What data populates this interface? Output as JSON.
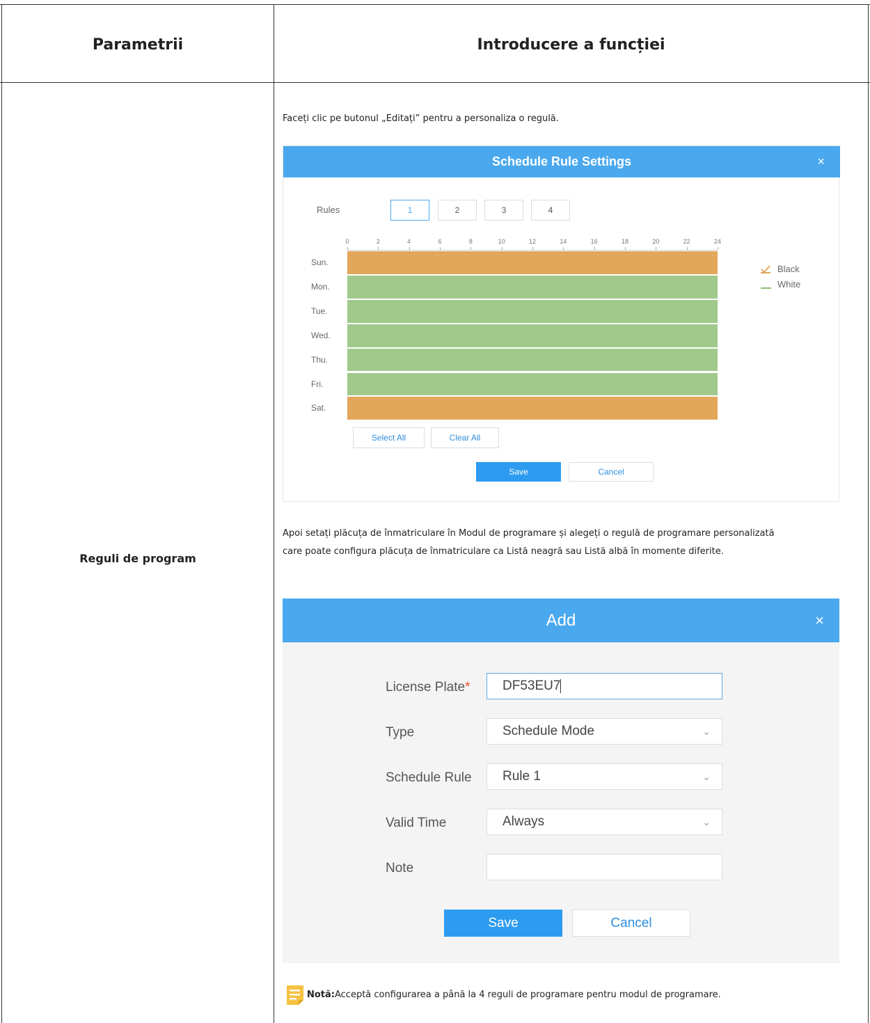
{
  "table": {
    "header_left": "Parametrii",
    "header_right": "Introducere a funcției",
    "row_param": "Reguli de program"
  },
  "content": {
    "intro": "Faceți clic pe butonul „Editați” pentru a personaliza o regulă.",
    "para_line1": "Apoi setați plăcuța de înmatriculare în Modul de programare și alegeți o regulă de programare personalizată",
    "para_line2": "care poate configura plăcuța de înmatriculare ca Listă neagră sau Listă albă în momente diferite.",
    "note_label": "Notă:",
    "note_text": "Acceptă configurarea a până la 4 reguli de programare pentru modul de programare."
  },
  "schedule_dialog": {
    "title": "Schedule Rule Settings",
    "close": "×",
    "rules_label": "Rules",
    "rules": [
      "1",
      "2",
      "3",
      "4"
    ],
    "selected_rule": "1",
    "hours": [
      "0",
      "2",
      "4",
      "6",
      "8",
      "10",
      "12",
      "14",
      "16",
      "18",
      "20",
      "22",
      "24"
    ],
    "days": [
      {
        "label": "Sun.",
        "list": "black"
      },
      {
        "label": "Mon.",
        "list": "white"
      },
      {
        "label": "Tue.",
        "list": "white"
      },
      {
        "label": "Wed.",
        "list": "white"
      },
      {
        "label": "Thu.",
        "list": "white"
      },
      {
        "label": "Fri.",
        "list": "white"
      },
      {
        "label": "Sat.",
        "list": "black"
      }
    ],
    "legend_black": "Black",
    "legend_white": "White",
    "colors": {
      "black_list": "#e2a75a",
      "white_list": "#a1c98c"
    },
    "select_all": "Select All",
    "clear_all": "Clear All",
    "save": "Save",
    "cancel": "Cancel"
  },
  "add_dialog": {
    "title": "Add",
    "close": "×",
    "license_plate_label": "License Plate",
    "required_mark": "*",
    "license_plate_value": "DF53EU7",
    "type_label": "Type",
    "type_value": "Schedule Mode",
    "schedule_rule_label": "Schedule Rule",
    "schedule_rule_value": "Rule 1",
    "valid_time_label": "Valid Time",
    "valid_time_value": "Always",
    "note_label": "Note",
    "note_value": "",
    "save": "Save",
    "cancel": "Cancel"
  }
}
